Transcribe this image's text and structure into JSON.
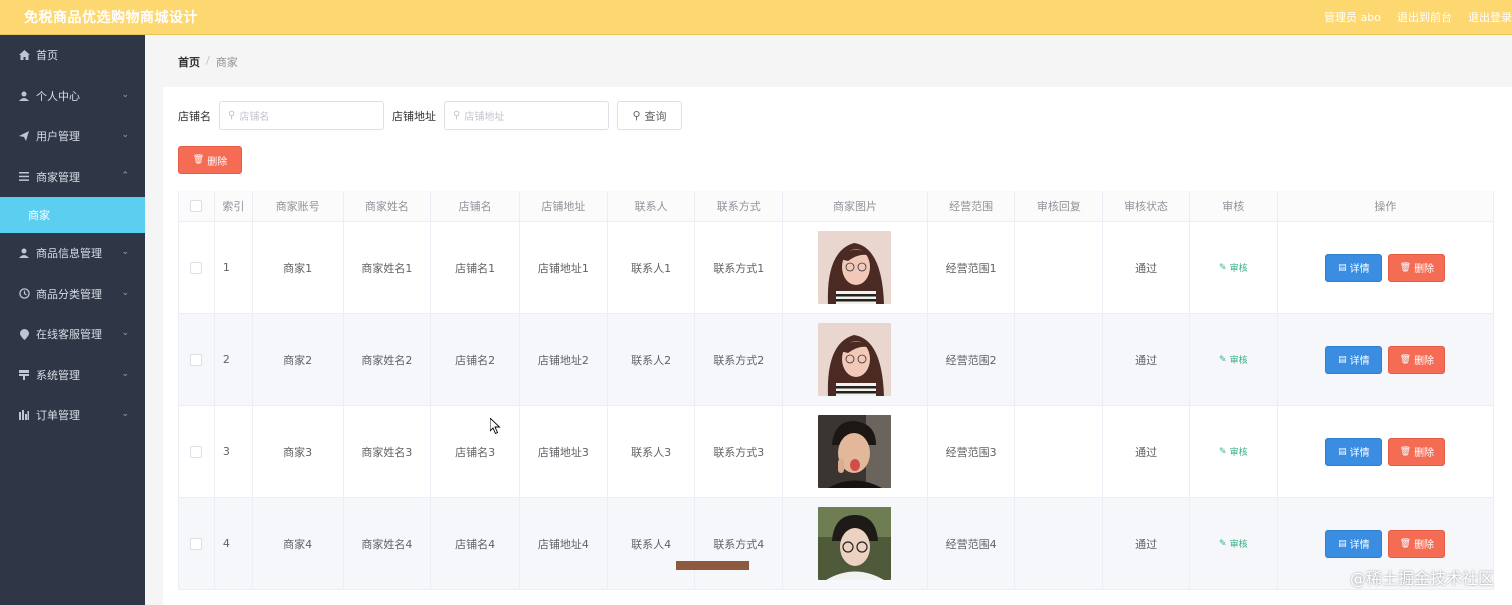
{
  "header": {
    "title": "免税商品优选购物商城设计",
    "admin": "管理员 abo",
    "back_to_front": "退出到前台",
    "logout": "退出登录"
  },
  "sidebar": {
    "items": [
      {
        "label": "首页",
        "icon": "home-icon",
        "chevron": false
      },
      {
        "label": "个人中心",
        "icon": "user-icon",
        "chevron": true
      },
      {
        "label": "用户管理",
        "icon": "send-icon",
        "chevron": true
      },
      {
        "label": "商家管理",
        "icon": "menu-icon",
        "chevron": true,
        "expanded": true
      },
      {
        "label": "商品信息管理",
        "icon": "user-icon",
        "chevron": true
      },
      {
        "label": "商品分类管理",
        "icon": "clock-icon",
        "chevron": true
      },
      {
        "label": "在线客服管理",
        "icon": "location-icon",
        "chevron": true
      },
      {
        "label": "系统管理",
        "icon": "system-icon",
        "chevron": true
      },
      {
        "label": "订单管理",
        "icon": "chart-icon",
        "chevron": true
      }
    ],
    "active_sub": "商家"
  },
  "breadcrumb": {
    "home": "首页",
    "separator": "/",
    "current": "商家"
  },
  "search": {
    "shop_name_label": "店铺名",
    "shop_name_placeholder": "店铺名",
    "shop_address_label": "店铺地址",
    "shop_address_placeholder": "店铺地址",
    "query_label": "查询"
  },
  "batch_delete_label": "删除",
  "table": {
    "headers": [
      "索引",
      "商家账号",
      "商家姓名",
      "店铺名",
      "店铺地址",
      "联系人",
      "联系方式",
      "商家图片",
      "经营范围",
      "审核回复",
      "审核状态",
      "审核",
      "操作"
    ],
    "rows": [
      {
        "index": "1",
        "account": "商家1",
        "name": "商家姓名1",
        "shop": "店铺名1",
        "address": "店铺地址1",
        "contact": "联系人1",
        "phone": "联系方式1",
        "scope": "经营范围1",
        "reply": "",
        "status": "通过"
      },
      {
        "index": "2",
        "account": "商家2",
        "name": "商家姓名2",
        "shop": "店铺名2",
        "address": "店铺地址2",
        "contact": "联系人2",
        "phone": "联系方式2",
        "scope": "经营范围2",
        "reply": "",
        "status": "通过"
      },
      {
        "index": "3",
        "account": "商家3",
        "name": "商家姓名3",
        "shop": "店铺名3",
        "address": "店铺地址3",
        "contact": "联系人3",
        "phone": "联系方式3",
        "scope": "经营范围3",
        "reply": "",
        "status": "通过"
      },
      {
        "index": "4",
        "account": "商家4",
        "name": "商家姓名4",
        "shop": "店铺名4",
        "address": "店铺地址4",
        "contact": "联系人4",
        "phone": "联系方式4",
        "scope": "经营范围4",
        "reply": "",
        "status": "通过"
      }
    ],
    "audit_label": "审核",
    "detail_label": "详情",
    "delete_label": "删除"
  },
  "watermark": "@稀土掘金技术社区",
  "colors": {
    "header": "#fdd76f",
    "sidebar": "#2f3645",
    "active_sub": "#5ccff0",
    "primary": "#3a8de0",
    "danger": "#f56c55",
    "success": "#3cb08a"
  }
}
